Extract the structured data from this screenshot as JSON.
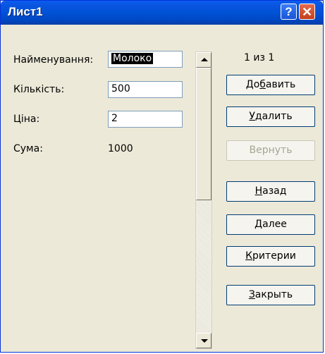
{
  "window": {
    "title": "Лист1"
  },
  "titlebar": {
    "help_glyph": "?",
    "close_glyph": "✕"
  },
  "form": {
    "name_label": "Найменування:",
    "name_value": "Молоко",
    "qty_label": "Кількість:",
    "qty_value": "500",
    "price_label": "Ціна:",
    "price_value": "2",
    "sum_label": "Сума:",
    "sum_value": "1000"
  },
  "record": {
    "counter": "1 из 1"
  },
  "buttons": {
    "add": {
      "pre": "До",
      "acc": "б",
      "post": "авить"
    },
    "delete": {
      "pre": "",
      "acc": "У",
      "post": "далить"
    },
    "restore": {
      "label": "Вернуть"
    },
    "back": {
      "pre": "",
      "acc": "Н",
      "post": "азад"
    },
    "next": {
      "pre": "",
      "acc": "Д",
      "post": "алее"
    },
    "criteria": {
      "pre": "",
      "acc": "К",
      "post": "ритерии"
    },
    "close": {
      "pre": "",
      "acc": "З",
      "post": "акрыть"
    }
  },
  "colors": {
    "accent": "#0052d6",
    "face": "#ece9d8"
  }
}
